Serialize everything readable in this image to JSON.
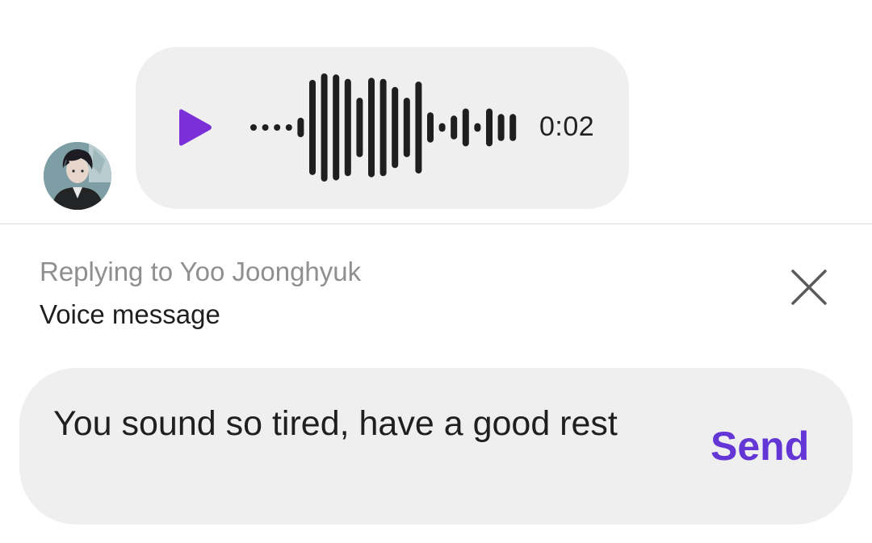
{
  "message": {
    "duration": "0:02",
    "accent_color": "#7b2fd6",
    "play_icon": "play-icon",
    "waveform_levels": [
      0.05,
      0.05,
      0.05,
      0.05,
      0.18,
      0.88,
      1.0,
      0.98,
      0.9,
      0.55,
      0.92,
      0.9,
      0.75,
      0.55,
      0.85,
      0.28,
      0.08,
      0.22,
      0.35,
      0.08,
      0.35,
      0.25,
      0.25
    ]
  },
  "reply": {
    "title": "Replying to Yoo Joonghyuk",
    "snippet": "Voice message",
    "close_icon": "close-icon"
  },
  "composer": {
    "text": "You sound so tired, have a good rest",
    "send_label": "Send",
    "send_color": "#6436d6"
  }
}
